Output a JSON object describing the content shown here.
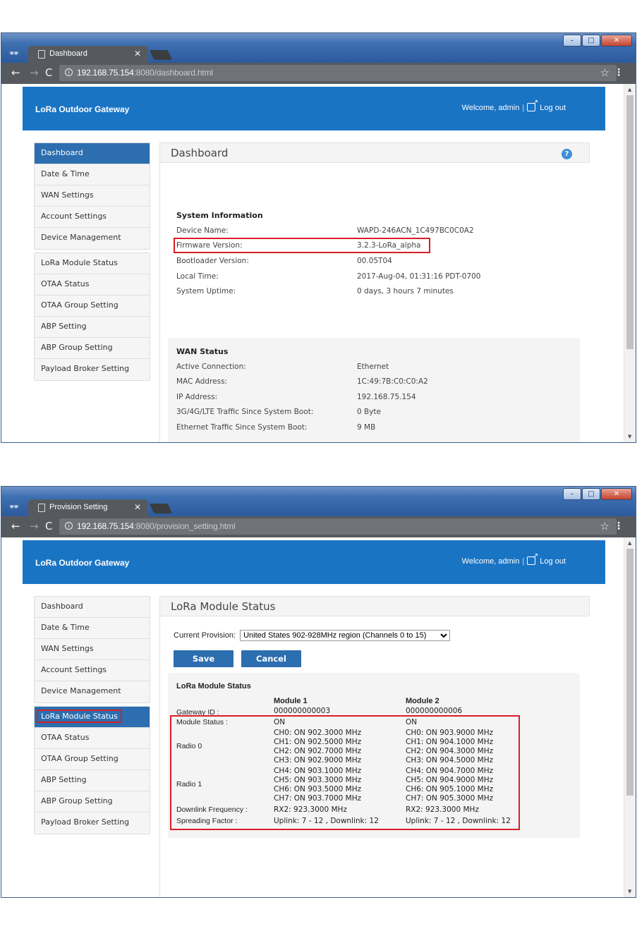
{
  "windows": [
    {
      "tab_title": "Dashboard",
      "url_host": "192.168.75.154",
      "url_path": ":8080/dashboard.html",
      "brand": "LoRa Outdoor Gateway",
      "welcome": "Welcome, admin",
      "separator": "|",
      "logout": "Log out",
      "sidebar": [
        "Dashboard",
        "Date & Time",
        "WAN Settings",
        "Account Settings",
        "Device Management",
        "LoRa Module Status",
        "OTAA Status",
        "OTAA Group Setting",
        "ABP Setting",
        "ABP Group Setting",
        "Payload Broker Setting"
      ],
      "active_item": "Dashboard",
      "page_title": "Dashboard",
      "system_info": {
        "heading": "System Information",
        "rows": [
          {
            "label": "Device Name:",
            "value": "WAPD-246ACN_1C497BC0C0A2"
          },
          {
            "label": "Firmware Version:",
            "value": "3.2.3-LoRa_alpha"
          },
          {
            "label": "Bootloader Version:",
            "value": "00.05T04"
          },
          {
            "label": "Local Time:",
            "value": "2017-Aug-04, 01:31:16 PDT-0700"
          },
          {
            "label": "System Uptime:",
            "value": "0 days, 3 hours 7 minutes"
          }
        ]
      },
      "wan_status": {
        "heading": "WAN Status",
        "rows": [
          {
            "label": "Active Connection:",
            "value": "Ethernet"
          },
          {
            "label": "MAC Address:",
            "value": "1C:49:7B:C0:C0:A2"
          },
          {
            "label": "IP Address:",
            "value": "192.168.75.154"
          },
          {
            "label": "3G/4G/LTE Traffic Since System Boot:",
            "value": "0 Byte"
          },
          {
            "label": "Ethernet Traffic Since System Boot:",
            "value": "9 MB"
          }
        ]
      }
    },
    {
      "tab_title": "Provision Setting",
      "url_host": "192.168.75.154",
      "url_path": ":8080/provision_setting.html",
      "brand": "LoRa Outdoor Gateway",
      "welcome": "Welcome, admin",
      "separator": "|",
      "logout": "Log out",
      "sidebar": [
        "Dashboard",
        "Date & Time",
        "WAN Settings",
        "Account Settings",
        "Device Management",
        "LoRa Module Status",
        "OTAA Status",
        "OTAA Group Setting",
        "ABP Setting",
        "ABP Group Setting",
        "Payload Broker Setting"
      ],
      "active_item": "LoRa Module Status",
      "page_title": "LoRa Module Status",
      "provision_label": "Current Provision:",
      "provision_value": "United States 902-928MHz region (Channels 0 to 15)",
      "save_label": "Save",
      "cancel_label": "Cancel",
      "lora_status": {
        "heading": "LoRa Module Status",
        "module1_title": "Module 1",
        "module2_title": "Module 2",
        "gateway_id_label": "Gateway ID :",
        "gateway_id": [
          "000000000003",
          "000000000006"
        ],
        "module_status_label": "Module Status :",
        "module_status": [
          "ON",
          "ON"
        ],
        "radio0_label": "Radio 0",
        "radio1_label": "Radio 1",
        "module1_channels": [
          "CH0: ON 902.3000 MHz",
          "CH1: ON 902.5000 MHz",
          "CH2: ON 902.7000 MHz",
          "CH3: ON 902.9000 MHz",
          "CH4: ON 903.1000 MHz",
          "CH5: ON 903.3000 MHz",
          "CH6: ON 903.5000 MHz",
          "CH7: ON 903.7000 MHz"
        ],
        "module2_channels": [
          "CH0: ON 903.9000 MHz",
          "CH1: ON 904.1000 MHz",
          "CH2: ON 904.3000 MHz",
          "CH3: ON 904.5000 MHz",
          "CH4: ON 904.7000 MHz",
          "CH5: ON 904.9000 MHz",
          "CH6: ON 905.1000 MHz",
          "CH7: ON 905.3000 MHz"
        ],
        "downlink_label": "Downlink Frequency :",
        "downlink": [
          "RX2: 923.3000 MHz",
          "RX2: 923.3000 MHz"
        ],
        "sf_label": "Spreading Factor :",
        "sf": [
          "Uplink: 7 - 12 , Downlink: 12",
          "Uplink: 7 - 12 , Downlink: 12"
        ]
      }
    }
  ],
  "colors": {
    "header_blue": "#1a74c4",
    "active_blue": "#2c6eaf",
    "highlight_red": "#d81e27"
  },
  "icons": [
    "incognito-icon",
    "page-icon",
    "close-icon",
    "back-arrow-icon",
    "forward-arrow-icon",
    "reload-icon",
    "info-icon",
    "star-icon",
    "menu-icon",
    "logout-icon",
    "help-icon"
  ]
}
